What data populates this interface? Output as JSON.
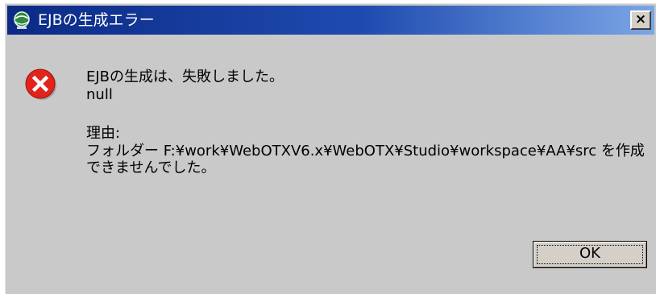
{
  "window": {
    "title": "EJBの生成エラー",
    "title_icon": "app-globe-icon",
    "close_label": "×",
    "titlebar_color": "#0b2a86"
  },
  "message": {
    "icon": "error-icon",
    "icon_color": "#e0241c",
    "headline": "EJBの生成は、失敗しました。",
    "detail": "null",
    "reason_label": "理由:",
    "reason_text": "フォルダー F:¥work¥WebOTXV6.x¥WebOTX¥Studio¥workspace¥AA¥src を作成できませんでした。"
  },
  "buttons": {
    "ok_label": "OK"
  }
}
